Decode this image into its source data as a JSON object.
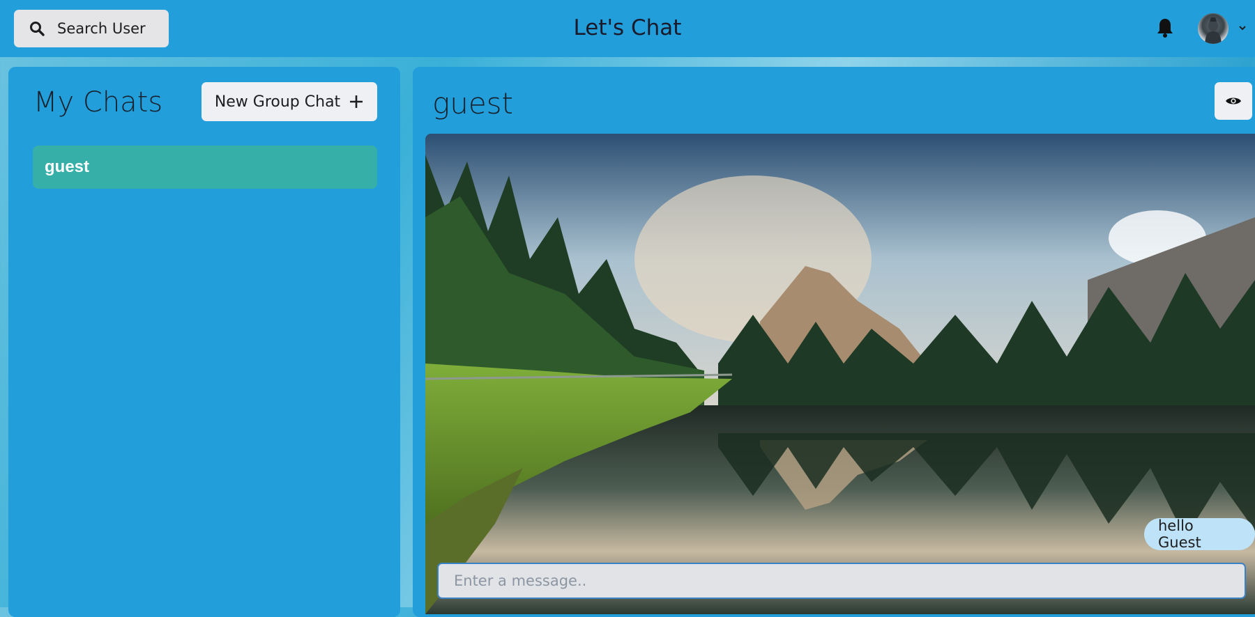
{
  "header": {
    "search_label": "Search User",
    "app_title": "Let's Chat"
  },
  "sidebar": {
    "title": "My Chats",
    "new_group_label": "New Group Chat",
    "chats": [
      {
        "name": "guest"
      }
    ]
  },
  "chat": {
    "title": "guest",
    "messages": [
      {
        "text": "hello Guest"
      }
    ],
    "input_placeholder": "Enter a message.."
  },
  "colors": {
    "primary": "#229fdb",
    "selected_chat": "#37afa9",
    "bubble": "#bee3f8"
  },
  "icons": {
    "search": "search-icon",
    "notifications": "bell-icon",
    "menu": "chevron-down-icon",
    "add": "plus-icon",
    "view_profile": "eye-icon"
  }
}
